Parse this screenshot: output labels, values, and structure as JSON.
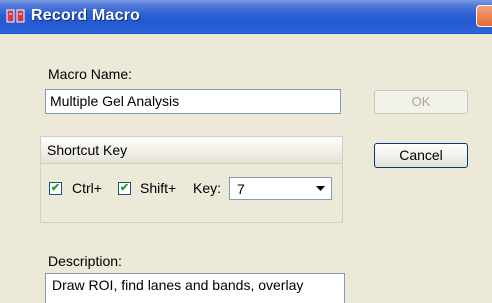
{
  "window": {
    "title": "Record Macro"
  },
  "labels": {
    "macro_name": "Macro Name:",
    "shortcut_key": "Shortcut Key",
    "ctrl": "Ctrl+",
    "shift": "Shift+",
    "key": "Key:",
    "description": "Description:"
  },
  "fields": {
    "macro_name_value": "Multiple Gel Analysis",
    "key_value": "7",
    "description_value": "Draw ROI, find lanes and bands, overlay"
  },
  "checkboxes": {
    "ctrl_checked": true,
    "shift_checked": true
  },
  "buttons": {
    "ok": "OK",
    "cancel": "Cancel"
  },
  "colors": {
    "titlebar": "#235ad2",
    "dialog_bg": "#ece9d8",
    "close": "#e36b33"
  },
  "icons": {
    "app": "macro-app-icon",
    "close": "close-icon",
    "dropdown": "chevron-down-icon",
    "check": "check-icon"
  }
}
